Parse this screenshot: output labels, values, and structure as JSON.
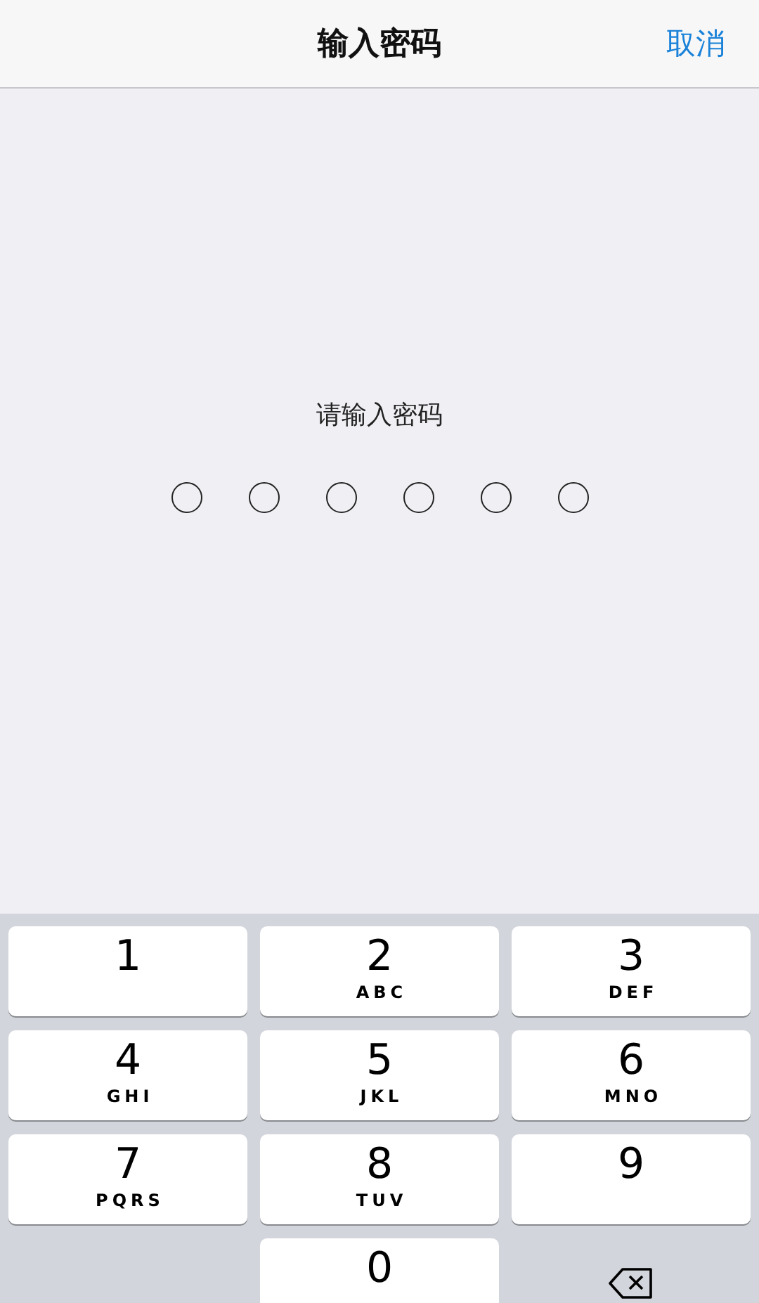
{
  "header": {
    "title": "输入密码",
    "cancel": "取消"
  },
  "prompt": "请输入密码",
  "passcode_dots": [
    {
      "filled": false
    },
    {
      "filled": false
    },
    {
      "filled": false
    },
    {
      "filled": false
    },
    {
      "filled": false
    },
    {
      "filled": false
    }
  ],
  "keypad": [
    {
      "kind": "digit",
      "digit": "1"
    },
    {
      "kind": "digit",
      "digit": "2",
      "letters": "ABC"
    },
    {
      "kind": "digit",
      "digit": "3",
      "letters": "DEF"
    },
    {
      "kind": "digit",
      "digit": "4",
      "letters": "GHI"
    },
    {
      "kind": "digit",
      "digit": "5",
      "letters": "JKL"
    },
    {
      "kind": "digit",
      "digit": "6",
      "letters": "MNO"
    },
    {
      "kind": "digit",
      "digit": "7",
      "letters": "PQRS"
    },
    {
      "kind": "digit",
      "digit": "8",
      "letters": "TUV"
    },
    {
      "kind": "digit",
      "digit": "9"
    },
    {
      "kind": "blank"
    },
    {
      "kind": "digit",
      "digit": "0"
    },
    {
      "kind": "delete"
    }
  ]
}
